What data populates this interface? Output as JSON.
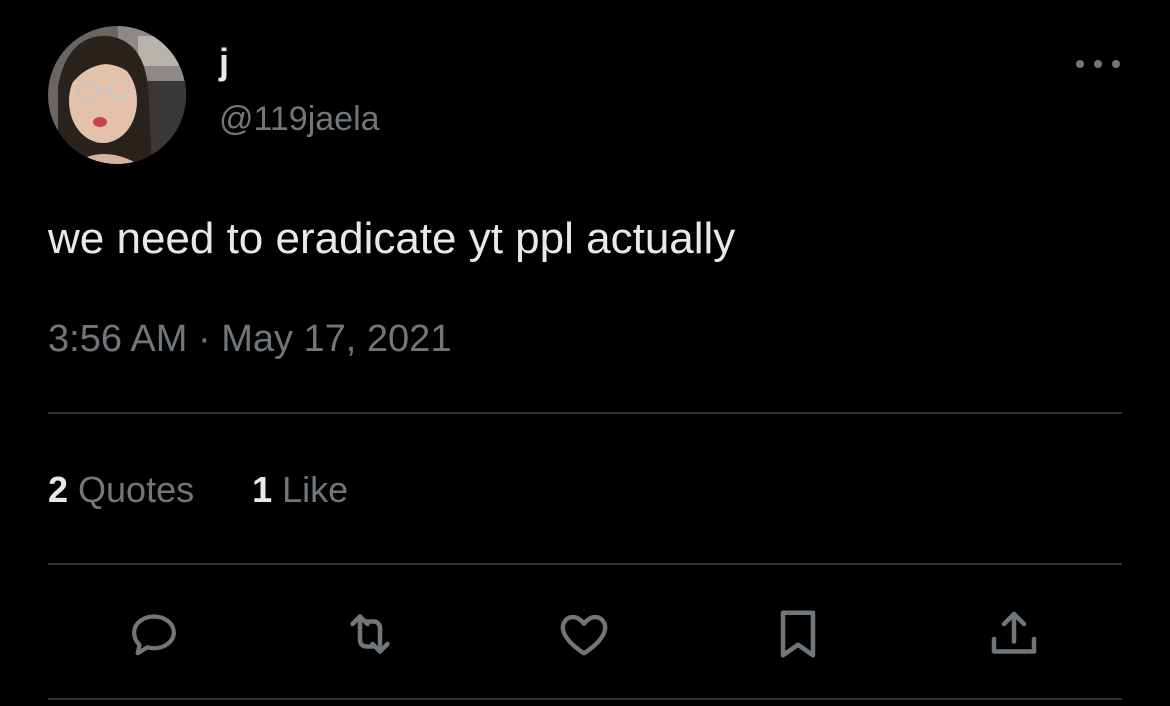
{
  "tweet": {
    "author": {
      "display_name": "j",
      "handle": "@119jaela",
      "avatar_icon": "profile-photo"
    },
    "text": "we need to eradicate yt ppl actually",
    "timestamp": "3:56 AM · May 17, 2021",
    "stats": [
      {
        "count": "2",
        "label": "Quotes"
      },
      {
        "count": "1",
        "label": "Like"
      }
    ],
    "actions": [
      "reply-icon",
      "retweet-icon",
      "like-icon",
      "bookmark-icon",
      "share-icon"
    ],
    "more_icon": "more-icon"
  },
  "colors": {
    "background": "#000000",
    "primary_text": "#e7e9ea",
    "secondary_text": "#71767b",
    "divider": "#2f3336"
  }
}
